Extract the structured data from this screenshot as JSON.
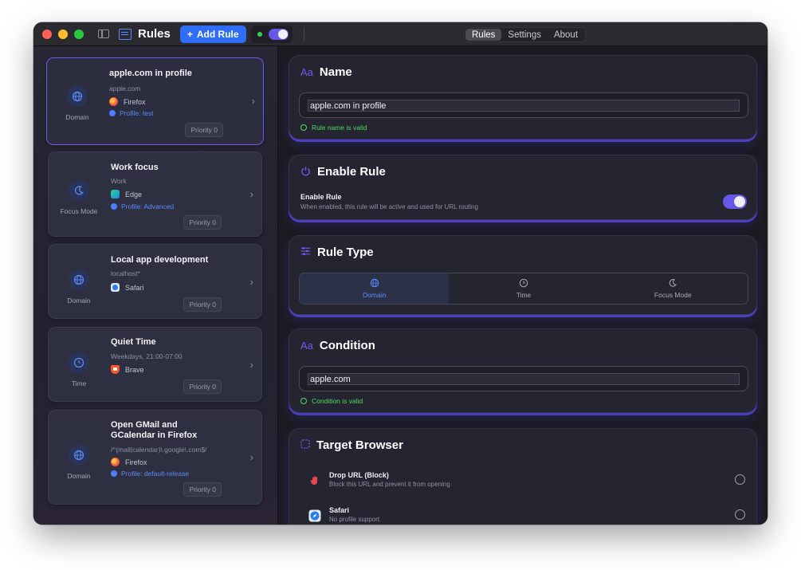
{
  "window": {
    "title": "Rules"
  },
  "toolbar": {
    "add_rule_label": "Add Rule",
    "add_rule_icon": "+",
    "tabs": [
      {
        "label": "Rules",
        "active": true
      },
      {
        "label": "Settings",
        "active": false
      },
      {
        "label": "About",
        "active": false
      }
    ]
  },
  "sidebar": {
    "rules": [
      {
        "kind": "Domain",
        "kind_icon": "globe-icon",
        "title": "apple.com in profile",
        "subtitle": "apple.com",
        "browser": "Firefox",
        "browser_icon": "firefox-icon",
        "profile": "Profile: test",
        "priority": "Priority 0",
        "selected": true
      },
      {
        "kind": "Focus Mode",
        "kind_icon": "moon-icon",
        "title": "Work focus",
        "subtitle": "Work",
        "browser": "Edge",
        "browser_icon": "edge-icon",
        "profile": "Profile: Advanced",
        "priority": "Priority 0",
        "selected": false
      },
      {
        "kind": "Domain",
        "kind_icon": "globe-icon",
        "title": "Local app development",
        "subtitle": "localhost*",
        "browser": "Safari",
        "browser_icon": "safari-icon",
        "profile": "",
        "priority": "Priority 0",
        "selected": false
      },
      {
        "kind": "Time",
        "kind_icon": "clock-icon",
        "title": "Quiet Time",
        "subtitle": "Weekdays, 21:00-07:00",
        "browser": "Brave",
        "browser_icon": "brave-icon",
        "profile": "",
        "priority": "Priority 0",
        "selected": false
      },
      {
        "kind": "Domain",
        "kind_icon": "globe-icon",
        "title_line1": "Open GMail and",
        "title_line2": "GCalendar in Firefox",
        "subtitle": "/^(mail|calendar)\\.google\\.com$/",
        "browser": "Firefox",
        "browser_icon": "firefox-icon",
        "profile": "Profile: default-release",
        "priority": "Priority 0",
        "selected": false
      }
    ]
  },
  "main": {
    "name": {
      "heading": "Name",
      "heading_icon": "Aa",
      "value": "apple.com in profile",
      "valid_text": "Rule name is valid"
    },
    "enable": {
      "heading": "Enable Rule",
      "label": "Enable Rule",
      "description": "When enabled, this rule will be active and used for URL routing",
      "enabled": true
    },
    "rule_type": {
      "heading": "Rule Type",
      "options": [
        {
          "label": "Domain",
          "icon": "globe-icon",
          "active": true
        },
        {
          "label": "Time",
          "icon": "clock-icon",
          "active": false
        },
        {
          "label": "Focus Mode",
          "icon": "moon-icon",
          "active": false
        }
      ]
    },
    "condition": {
      "heading": "Condition",
      "heading_icon": "Aa",
      "value": "apple.com",
      "valid_text": "Condition is valid"
    },
    "target": {
      "heading": "Target Browser",
      "browsers": [
        {
          "title": "Drop URL (Block)",
          "subtitle": "Block this URL and prevent it from opening",
          "icon": "hand-block-icon"
        },
        {
          "title": "Safari",
          "subtitle": "No profile support",
          "icon": "safari-icon"
        }
      ]
    }
  },
  "colors": {
    "accent_purple": "#6757e8",
    "accent_blue": "#2f6df6",
    "valid_green": "#4cd964",
    "link_blue": "#5b8cff"
  }
}
